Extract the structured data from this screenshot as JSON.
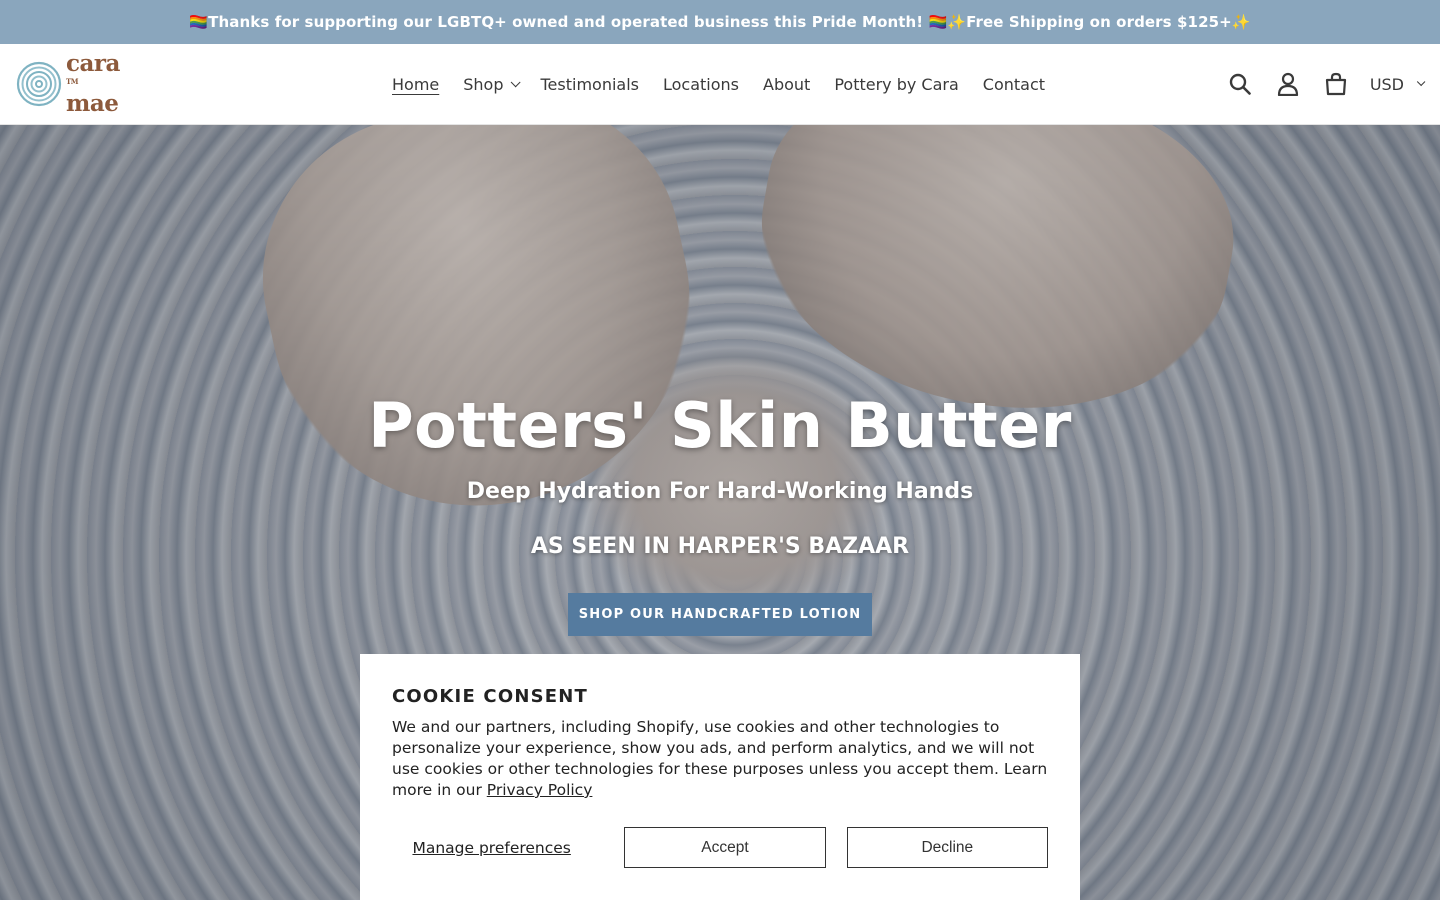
{
  "announcement": {
    "text": "🏳️‍🌈Thanks for supporting our LGBTQ+ owned and operated business this Pride Month! 🏳️‍🌈✨Free Shipping on orders $125+✨"
  },
  "logo": {
    "line1": "cara",
    "line2": "mae",
    "tm": "TM",
    "brand_color": "#8d5a3c",
    "swirl_color": "#7fb3c2"
  },
  "nav": {
    "items": [
      {
        "label": "Home",
        "active": true
      },
      {
        "label": "Shop",
        "has_dropdown": true
      },
      {
        "label": "Testimonials"
      },
      {
        "label": "Locations"
      },
      {
        "label": "About"
      },
      {
        "label": "Pottery by Cara"
      },
      {
        "label": "Contact"
      }
    ]
  },
  "header_icons": {
    "search": "search-icon",
    "account": "account-icon",
    "cart": "cart-icon",
    "currency": "USD"
  },
  "hero": {
    "title": "Potters' Skin Butter",
    "subtitle": "Deep Hydration For Hard-Working Hands",
    "press": "AS SEEN IN HARPER'S BAZAAR",
    "cta": "SHOP OUR HANDCRAFTED LOTION",
    "cta_color": "#557b9f"
  },
  "cookie": {
    "title": "COOKIE CONSENT",
    "text": "We and our partners, including Shopify, use cookies and other technologies to personalize your experience, show you ads, and perform analytics, and we will not use cookies or other technologies for these purposes unless you accept them. Learn more in our ",
    "privacy_link": "Privacy Policy",
    "manage": "Manage preferences",
    "accept": "Accept",
    "decline": "Decline"
  },
  "colors": {
    "announcement_bg": "#8aa6bd"
  }
}
